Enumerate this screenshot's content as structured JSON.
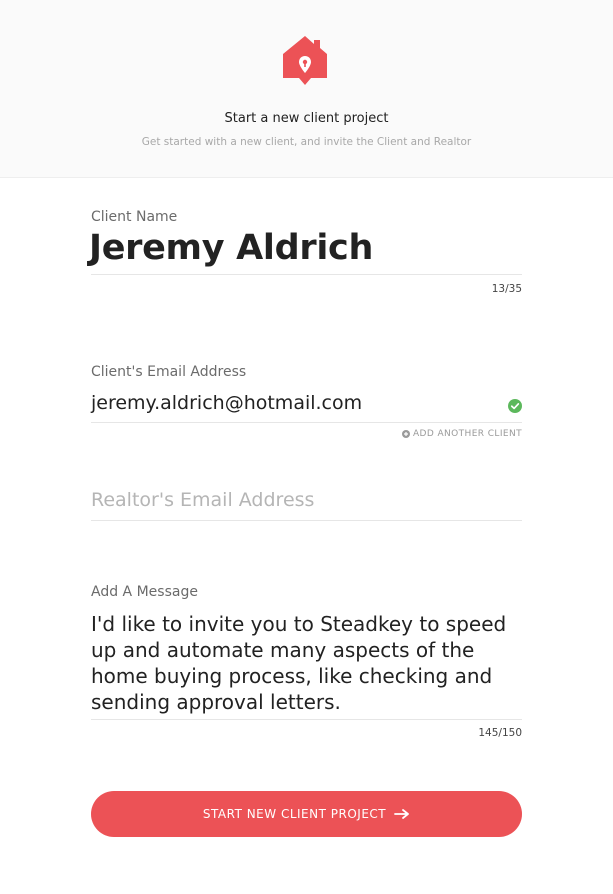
{
  "header": {
    "title": "Start a new client project",
    "subtitle": "Get started with a new client, and invite the Client and Realtor",
    "logo_icon": "house-keyhole-logo-icon",
    "brand_color": "#ec5256"
  },
  "client_name": {
    "label": "Client Name",
    "value": "Jeremy Aldrich",
    "counter": "13/35"
  },
  "client_email": {
    "label": "Client's Email Address",
    "value": "jeremy.aldrich@hotmail.com",
    "status_icon": "check-circle-icon",
    "status_color": "#5cb85c",
    "add_another_label": "ADD ANOTHER CLIENT"
  },
  "realtor_email": {
    "placeholder": "Realtor's Email Address",
    "value": ""
  },
  "message": {
    "label": "Add A Message",
    "value": "I'd like to invite you to Steadkey to speed up and automate many aspects of the home buying process, like checking and sending approval letters.",
    "counter": "145/150"
  },
  "submit": {
    "label": "START NEW CLIENT PROJECT",
    "icon": "arrow-right-icon"
  }
}
